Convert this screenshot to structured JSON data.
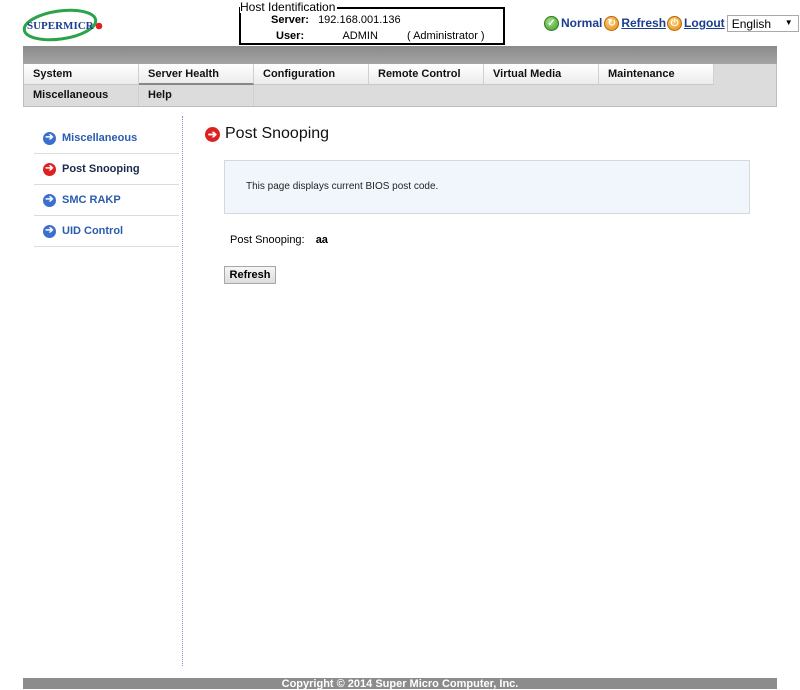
{
  "brand": {
    "logo_text": "SUPERMICR",
    "logo_dot_color": "#e02020",
    "logo_ring_color": "#2aa34a"
  },
  "host_identification": {
    "legend": "Host Identification",
    "server_label": "Server:",
    "server_value": "192.168.001.136",
    "user_label": "User:",
    "user_value": "ADMIN",
    "user_role": "( Administrator )"
  },
  "top_right": {
    "status_label": "Normal",
    "refresh_label": "Refresh",
    "logout_label": "Logout",
    "language_selected": "English",
    "dropdown_arrow": "▼"
  },
  "menu": {
    "row1": [
      "System",
      "Server Health",
      "Configuration",
      "Remote Control",
      "Virtual Media",
      "Maintenance"
    ],
    "row2": [
      "Miscellaneous",
      "Help"
    ]
  },
  "sidenav": {
    "items": [
      {
        "label": "Miscellaneous",
        "active": false
      },
      {
        "label": "Post Snooping",
        "active": true
      },
      {
        "label": "SMC RAKP",
        "active": false
      },
      {
        "label": "UID Control",
        "active": false
      }
    ]
  },
  "content": {
    "title": "Post Snooping",
    "info_text": "This page displays current BIOS post code.",
    "field_label": "Post Snooping:",
    "field_value": "aa",
    "refresh_button": "Refresh"
  },
  "footer": {
    "copyright": "Copyright © 2014 Super Micro Computer, Inc."
  },
  "icons": {
    "arrow": "➔",
    "check": "✓"
  },
  "colors": {
    "link": "#1a3d8f",
    "nav_link": "#2a5cae",
    "accent_red": "#e02020",
    "info_bg": "#f1f6fd"
  }
}
